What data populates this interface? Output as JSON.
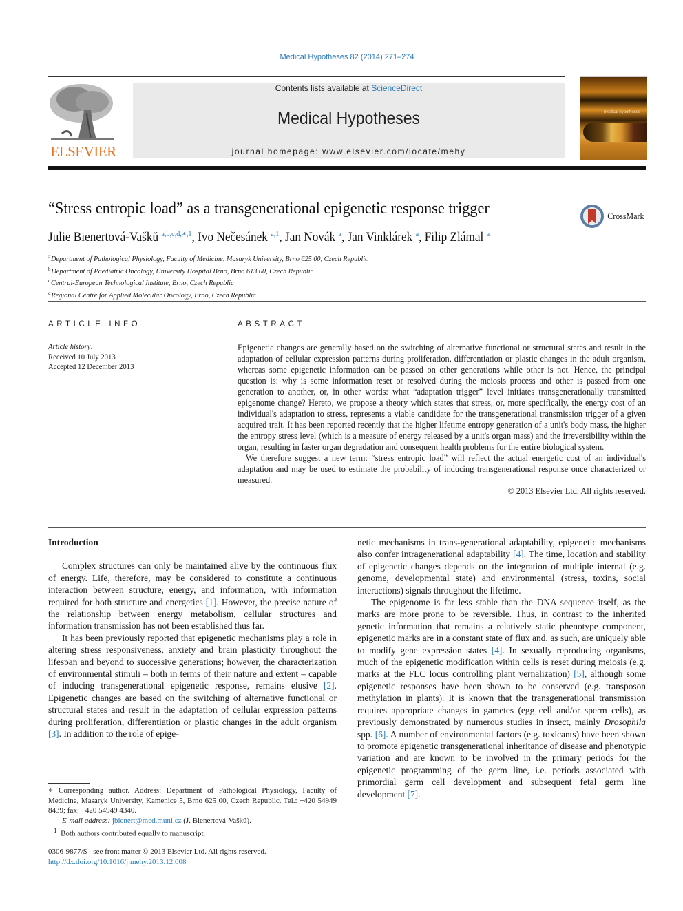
{
  "header": {
    "citation": "Medical Hypotheses 82 (2014) 271–274",
    "contents_prefix": "Contents lists available at ",
    "contents_link": "ScienceDirect",
    "journal_name": "Medical Hypotheses",
    "homepage": "journal homepage: www.elsevier.com/locate/mehy",
    "publisher_wordmark": "ELSEVIER",
    "cover_title": "medical hypotheses",
    "colors": {
      "link": "#2a7bb8",
      "elsevier_orange": "#e9711c",
      "masthead_bg": "#eaeaea"
    }
  },
  "article": {
    "title": "“Stress entropic load” as a transgenerational epigenetic response trigger",
    "crossmark_label": "CrossMark",
    "authors": [
      {
        "name": "Julie Bienertová-Vaškŭ",
        "sup": "a,b,c,d,∗,1",
        "sep": ", "
      },
      {
        "name": "Ivo Nečesánek",
        "sup": "a,1",
        "sep": ", "
      },
      {
        "name": "Jan Novák",
        "sup": "a",
        "sep": ", "
      },
      {
        "name": "Jan Vinklárek",
        "sup": "a",
        "sep": ", "
      },
      {
        "name": "Filip Zlámal",
        "sup": "a",
        "sep": ""
      }
    ],
    "affiliations": [
      {
        "key": "a",
        "text": "Department of Pathological Physiology, Faculty of Medicine, Masaryk University, Brno 625 00, Czech Republic"
      },
      {
        "key": "b",
        "text": "Department of Paediatric Oncology, University Hospital Brno, Brno 613 00, Czech Republic"
      },
      {
        "key": "c",
        "text": "Central-European Technological Institute, Brno, Czech Republic"
      },
      {
        "key": "d",
        "text": "Regional Centre for Applied Molecular Oncology, Brno, Czech Republic"
      }
    ]
  },
  "article_info": {
    "heading": "ARTICLE INFO",
    "history_label": "Article history:",
    "received": "Received 10 July 2013",
    "accepted": "Accepted 12 December 2013"
  },
  "abstract": {
    "heading": "ABSTRACT",
    "paragraph1": "Epigenetic changes are generally based on the switching of alternative functional or structural states and result in the adaptation of cellular expression patterns during proliferation, differentiation or plastic changes in the adult organism, whereas some epigenetic information can be passed on other generations while other is not. Hence, the principal question is: why is some information reset or resolved during the meiosis process and other is passed from one generation to another, or, in other words: what “adaptation trigger” level initiates transgenerationally transmitted epigenome change? Hereto, we propose a theory which states that stress, or, more specifically, the energy cost of an individual's adaptation to stress, represents a viable candidate for the transgenerational transmission trigger of a given acquired trait. It has been reported recently that the higher lifetime entropy generation of a unit's body mass, the higher the entropy stress level (which is a measure of energy released by a unit's organ mass) and the irreversibility within the organ, resulting in faster organ degradation and consequent health problems for the entire biological system.",
    "paragraph2": "We therefore suggest a new term: “stress entropic load” will reflect the actual energetic cost of an individual's adaptation and may be used to estimate the probability of inducing transgenerational response once characterized or measured.",
    "copyright": "© 2013 Elsevier Ltd. All rights reserved."
  },
  "body": {
    "intro_heading": "Introduction",
    "left_p1_a": "Complex structures can only be maintained alive by the continuous flux of energy. Life, therefore, may be considered to constitute a continuous interaction between structure, energy, and information, with information required for both structure and energetics ",
    "ref1": "[1]",
    "left_p1_b": ". However, the precise nature of the relationship between energy metabolism, cellular structures and information transmission has not been established thus far.",
    "left_p2_a": "It has been previously reported that epigenetic mechanisms play a role in altering stress responsiveness, anxiety and brain plasticity throughout the lifespan and beyond to successive generations; however, the characterization of environmental stimuli – both in terms of their nature and extent – capable of inducing transgenerational epigenetic response, remains elusive ",
    "ref2": "[2]",
    "left_p2_b": ". Epigenetic changes are based on the switching of alternative functional or structural states and result in the adaptation of cellular expression patterns during proliferation, differentiation or plastic changes in the adult organism ",
    "ref3": "[3]",
    "left_p2_c": ". In addition to the role of epige-",
    "right_p1_a": "netic mechanisms in trans-generational adaptability, epigenetic mechanisms also confer intragenerational adaptability ",
    "ref4": "[4]",
    "right_p1_b": ". The time, location and stability of epigenetic changes depends on the integration of multiple internal (e.g. genome, developmental state) and environmental (stress, toxins, social interactions) signals throughout the lifetime.",
    "right_p2_a": "The epigenome is far less stable than the DNA sequence itself, as the marks are more prone to be reversible. Thus, in contrast to the inherited genetic information that remains a relatively static phenotype component, epigenetic marks are in a constant state of flux and, as such, are uniquely able to modify gene expression states ",
    "ref4b": "[4]",
    "right_p2_b": ". In sexually reproducing organisms, much of the epigenetic modification within cells is reset during meiosis (e.g. marks at the FLC locus controlling plant vernalization) ",
    "ref5": "[5]",
    "right_p2_c": ", although some epigenetic responses have been shown to be conserved (e.g. transposon methylation in plants). It is known that the transgenerational transmission requires appropriate changes in gametes (egg cell and/or sperm cells), as previously demonstrated by numerous studies in insect, mainly ",
    "drosophila": "Drosophila",
    "right_p2_d": " spp. ",
    "ref6": "[6]",
    "right_p2_e": ". A number of environmental factors (e.g. toxicants) have been shown to promote epigenetic transgenerational inheritance of disease and phenotypic variation and are known to be involved in the primary periods for the epigenetic programming of the germ line, i.e. periods associated with primordial germ cell development and subsequent fetal germ line development ",
    "ref7": "[7]",
    "right_p2_f": "."
  },
  "footnotes": {
    "corresponding": "∗ Corresponding author. Address: Department of Pathological Physiology, Faculty of Medicine, Masaryk University, Kamenice 5, Brno 625 00, Czech Republic. Tel.: +420 54949 8439; fax: +420 54949 4340.",
    "email_label": "E-mail address:",
    "email": "jbienert@med.muni.cz",
    "email_owner": " (J. Bienertová-Vaškŭ).",
    "note1_mark": "1",
    "note1": "Both authors contributed equally to manuscript."
  },
  "front_matter": {
    "issn_line": "0306-9877/$ - see front matter © 2013 Elsevier Ltd. All rights reserved.",
    "doi": "http://dx.doi.org/10.1016/j.mehy.2013.12.008"
  }
}
